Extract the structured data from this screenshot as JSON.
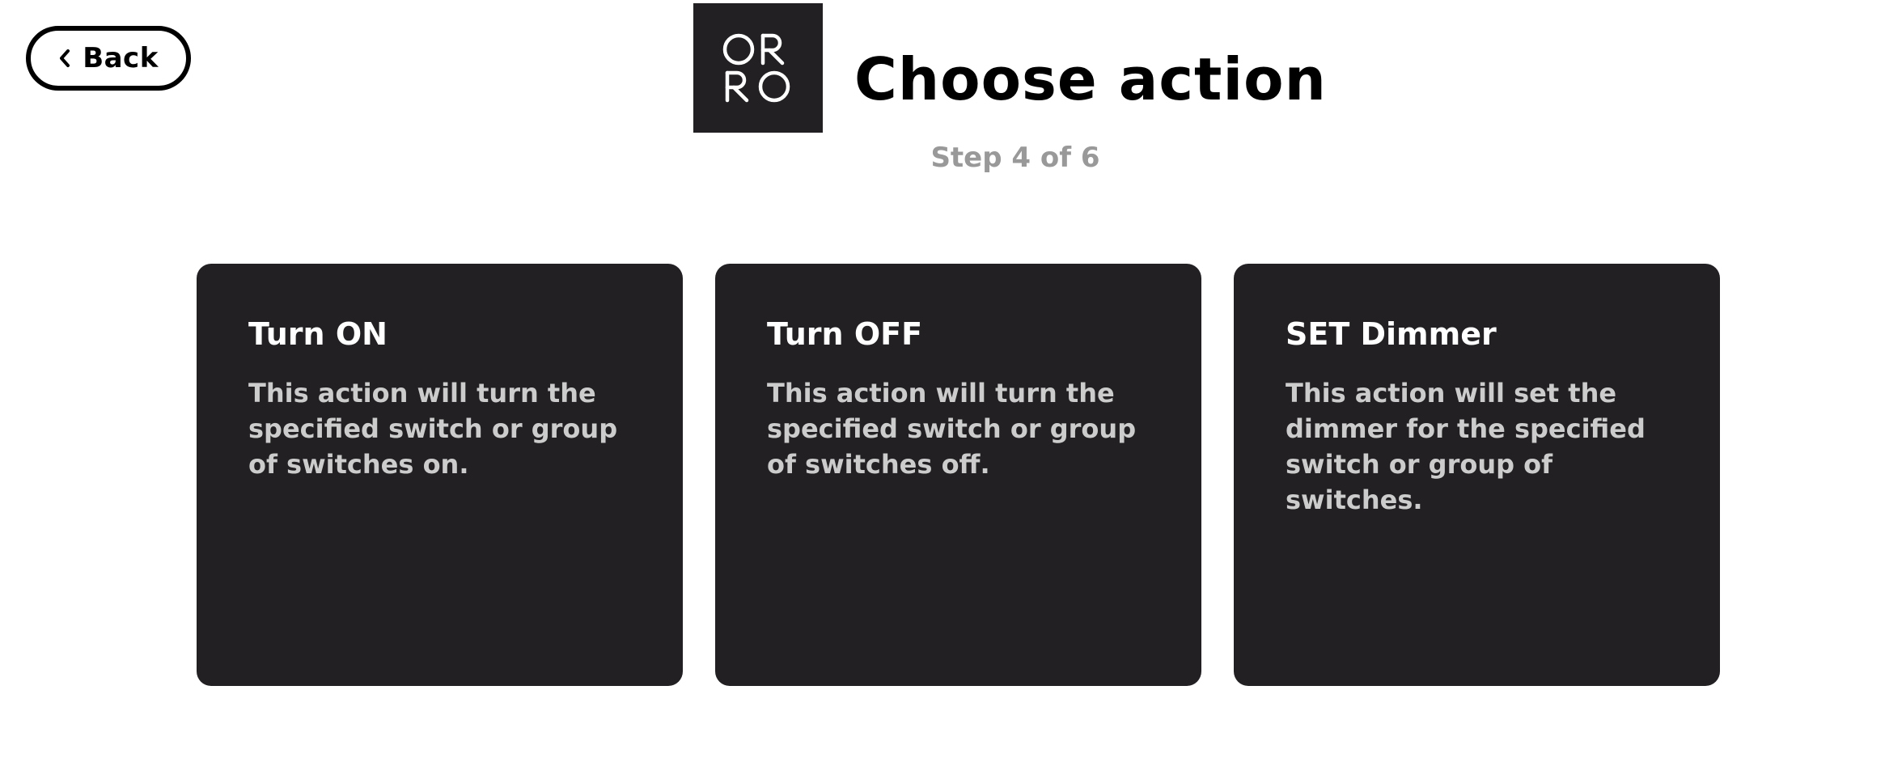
{
  "header": {
    "back_label": "Back",
    "title": "Choose action",
    "step": "Step 4 of 6",
    "logo": {
      "icon": "orro-logo",
      "lines": [
        "OR",
        "RO"
      ]
    }
  },
  "actions": [
    {
      "title": "Turn ON",
      "description": "This action will turn the specified switch or group of switches on."
    },
    {
      "title": "Turn OFF",
      "description": "This action will turn the specified switch or group of switches off."
    },
    {
      "title": "SET Dimmer",
      "description": "This action will set the dimmer for the specified switch or group of switches."
    }
  ],
  "colors": {
    "card_background": "#222022",
    "card_title": "#ffffff",
    "card_text": "#cccccc",
    "step_text": "#999999",
    "logo_background": "#222022"
  }
}
